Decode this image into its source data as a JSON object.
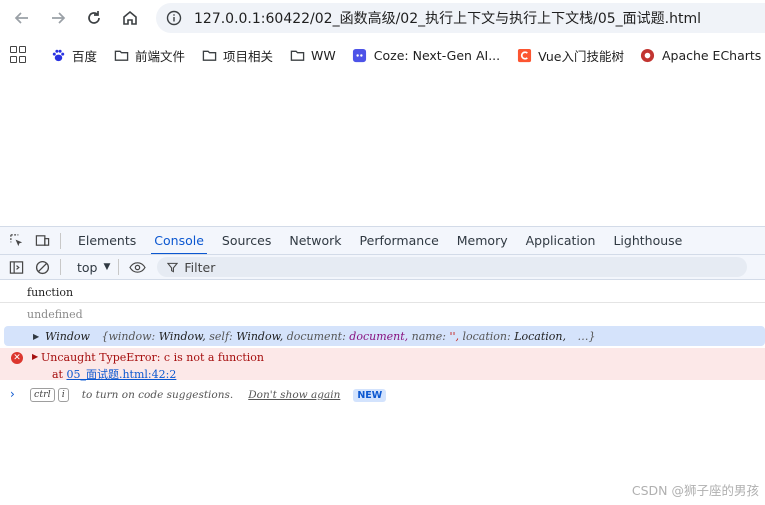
{
  "browser": {
    "url": "127.0.0.1:60422/02_函数高级/02_执行上下文与执行上下文栈/05_面试题.html"
  },
  "bookmarks": [
    {
      "label": "百度",
      "icon": "baidu-paw-icon",
      "color": "#2932e1"
    },
    {
      "label": "前端文件",
      "icon": "folder-icon"
    },
    {
      "label": "项目相关",
      "icon": "folder-icon"
    },
    {
      "label": "WW",
      "icon": "folder-icon"
    },
    {
      "label": "Coze: Next-Gen AI...",
      "icon": "coze-icon",
      "color": "#4d53e8"
    },
    {
      "label": "Vue入门技能树",
      "icon": "csdn-c-icon",
      "color": "#fc5531"
    },
    {
      "label": "Apache ECharts",
      "icon": "echarts-icon",
      "color": "#c23531"
    }
  ],
  "devtools": {
    "tabs": [
      "Elements",
      "Console",
      "Sources",
      "Network",
      "Performance",
      "Memory",
      "Application",
      "Lighthouse"
    ],
    "active_tab": "Console",
    "context": "top",
    "filter_placeholder": "Filter"
  },
  "console": {
    "line1": "function",
    "line2": "undefined",
    "window_obj": {
      "name": "Window",
      "open_brace": "{",
      "k1": "window:",
      "v1": "Window,",
      "k2": "self:",
      "v2": "Window,",
      "k3": "document:",
      "v3": "document,",
      "k4": "name:",
      "v4": "'',",
      "k5": "location:",
      "v5": "Location,",
      "ellipsis": "…}"
    },
    "error": {
      "message": "Uncaught TypeError: c is not a function",
      "at": "at",
      "link": "05_面试题.html:42:2"
    },
    "hint": {
      "key1": "ctrl",
      "key2": "i",
      "text": "to turn on code suggestions.",
      "dont_show": "Don't show again",
      "badge": "NEW"
    }
  },
  "watermark": "CSDN @狮子座的男孩"
}
